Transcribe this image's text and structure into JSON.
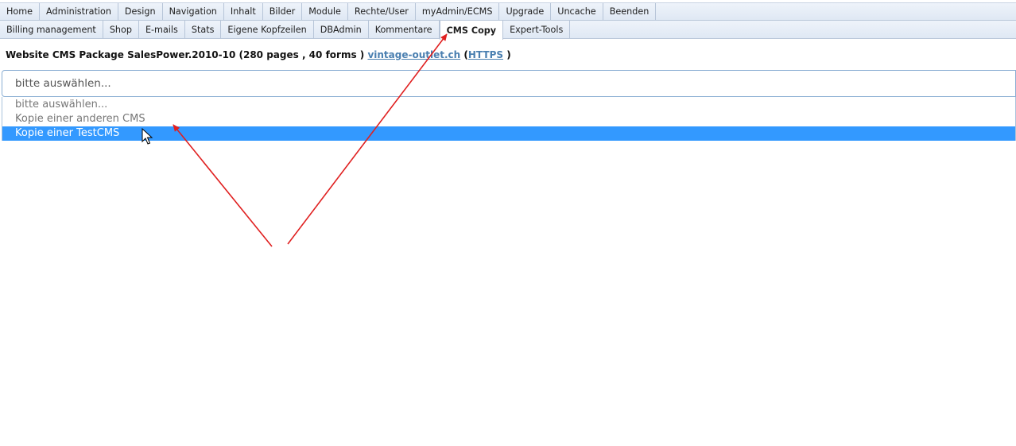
{
  "nav_primary": [
    {
      "label": "Home"
    },
    {
      "label": "Administration"
    },
    {
      "label": "Design"
    },
    {
      "label": "Navigation"
    },
    {
      "label": "Inhalt"
    },
    {
      "label": "Bilder"
    },
    {
      "label": "Module"
    },
    {
      "label": "Rechte/User"
    },
    {
      "label": "myAdmin/ECMS"
    },
    {
      "label": "Upgrade"
    },
    {
      "label": "Uncache"
    },
    {
      "label": "Beenden"
    }
  ],
  "nav_secondary": [
    {
      "label": "Billing management"
    },
    {
      "label": "Shop"
    },
    {
      "label": "E-mails"
    },
    {
      "label": "Stats"
    },
    {
      "label": "Eigene Kopfzeilen"
    },
    {
      "label": "DBAdmin"
    },
    {
      "label": "Kommentare"
    },
    {
      "label": "CMS Copy",
      "active": true
    },
    {
      "label": "Expert-Tools"
    }
  ],
  "info": {
    "text": "Website CMS Package SalesPower.2010-10 (280 pages , 40 forms )",
    "domain_link": "vintage-outlet.ch",
    "open_paren": "(",
    "https_link": "HTTPS",
    "close_paren": ")"
  },
  "select": {
    "value": "bitte auswählen...",
    "options": [
      "bitte auswählen...",
      "Kopie einer anderen CMS",
      "Kopie einer TestCMS"
    ],
    "selected_index": 2
  },
  "colors": {
    "highlight": "#3399ff",
    "annotation_arrow": "#e02020",
    "link": "#4a7fb0"
  }
}
